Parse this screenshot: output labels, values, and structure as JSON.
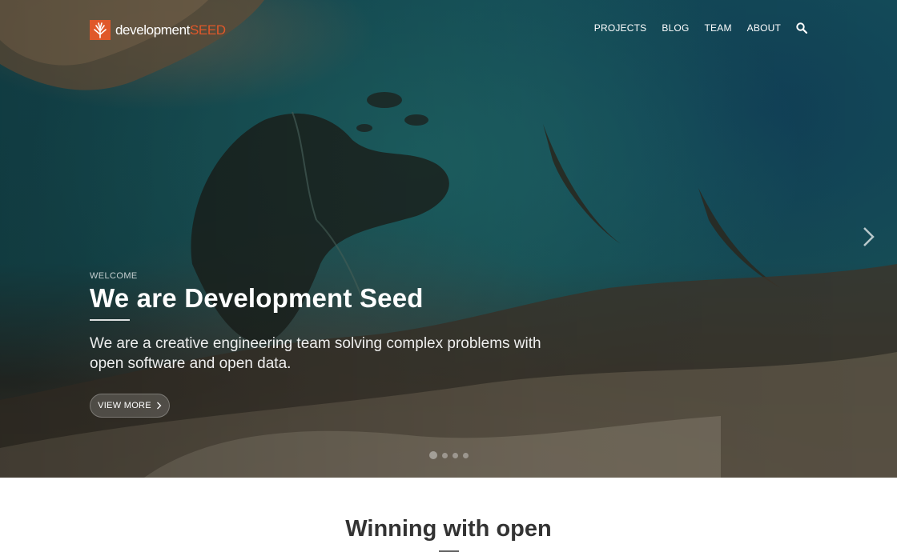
{
  "brand": {
    "name_part1": "development",
    "name_part2": "SEED",
    "accent_color": "#e0582a"
  },
  "nav": {
    "items": [
      {
        "label": "PROJECTS"
      },
      {
        "label": "BLOG"
      },
      {
        "label": "TEAM"
      },
      {
        "label": "ABOUT"
      }
    ],
    "search_icon": "search-icon"
  },
  "hero": {
    "eyebrow": "WELCOME",
    "title": "We are Development Seed",
    "lead": "We are a creative engineering team solving complex problems with open software and open data.",
    "button_label": "VIEW MORE",
    "next_icon": "chevron-right-icon",
    "slides": {
      "count": 4,
      "active_index": 0
    }
  },
  "section": {
    "title": "Winning with open"
  }
}
